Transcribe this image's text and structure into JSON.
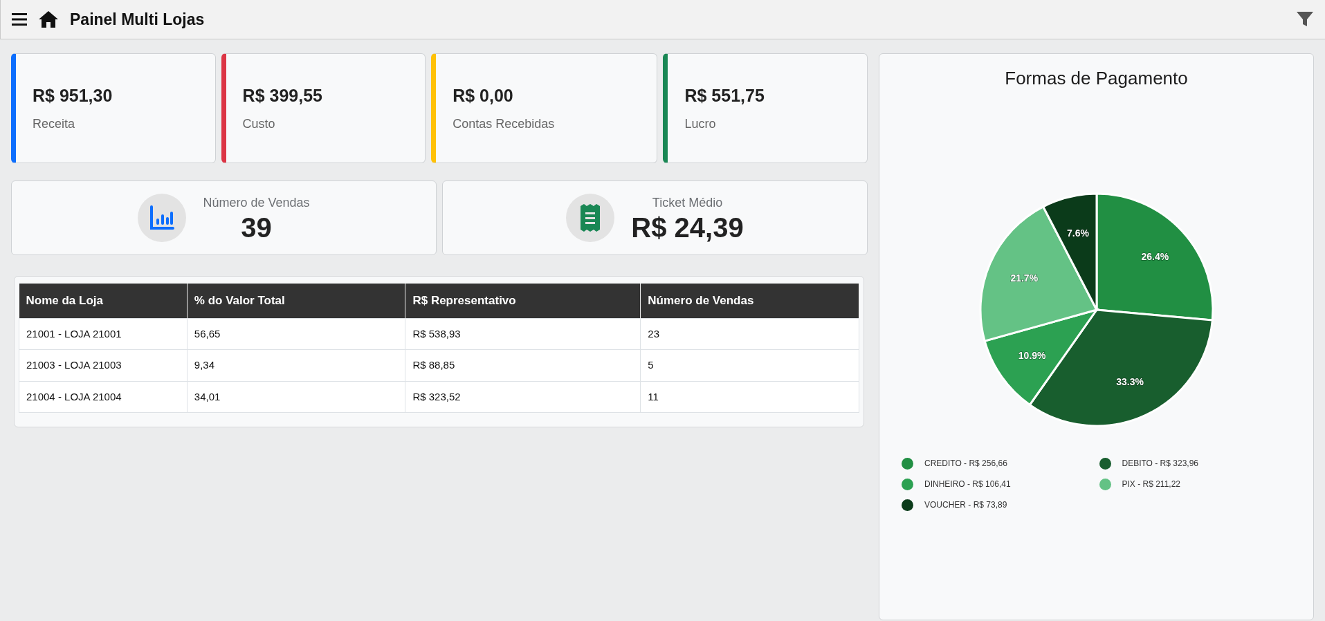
{
  "header": {
    "title": "Painel Multi Lojas"
  },
  "kpis": [
    {
      "value": "R$ 951,30",
      "label": "Receita",
      "color": "#0d6efd"
    },
    {
      "value": "R$ 399,55",
      "label": "Custo",
      "color": "#dc3545"
    },
    {
      "value": "R$ 0,00",
      "label": "Contas Recebidas",
      "color": "#ffc107"
    },
    {
      "value": "R$ 551,75",
      "label": "Lucro",
      "color": "#198754"
    }
  ],
  "stats": [
    {
      "label": "Número de Vendas",
      "value": "39"
    },
    {
      "label": "Ticket Médio",
      "value": "R$ 24,39"
    }
  ],
  "table": {
    "columns": [
      "Nome da Loja",
      "% do Valor Total",
      "R$ Representativo",
      "Número de Vendas"
    ],
    "rows": [
      [
        "21001 - LOJA 21001",
        "56,65",
        "R$ 538,93",
        "23"
      ],
      [
        "21003 - LOJA 21003",
        "9,34",
        "R$ 88,85",
        "5"
      ],
      [
        "21004 - LOJA 21004",
        "34,01",
        "R$ 323,52",
        "11"
      ]
    ]
  },
  "payment_chart": {
    "chart_data": {
      "type": "pie",
      "title": "Formas de Pagamento",
      "values": [
        26.4,
        33.3,
        10.9,
        21.7,
        7.6
      ],
      "value_labels": [
        "26.4%",
        "33.3%",
        "10.9%",
        "21.7%",
        "7.6%"
      ]
    },
    "legend": [
      {
        "label": "CREDITO - R$ 256,66",
        "color": "#218f43"
      },
      {
        "label": "DEBITO - R$ 323,96",
        "color": "#185e2e"
      },
      {
        "label": "DINHEIRO - R$ 106,41",
        "color": "#2ca152"
      },
      {
        "label": "PIX - R$ 211,22",
        "color": "#64c285"
      },
      {
        "label": "VOUCHER - R$ 73,89",
        "color": "#0b3b1a"
      }
    ]
  }
}
